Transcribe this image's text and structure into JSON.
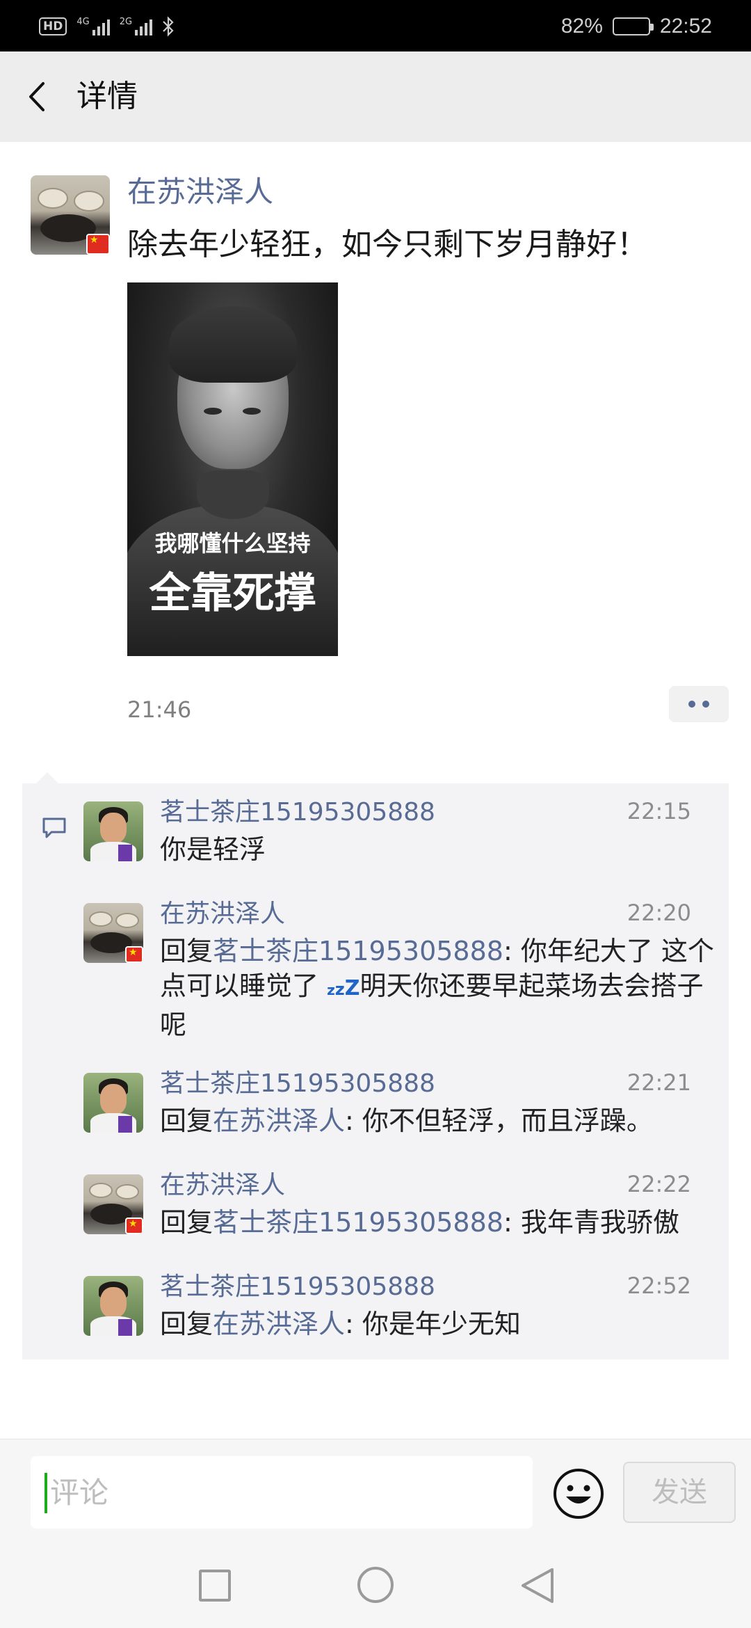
{
  "status_bar": {
    "hd": "HD",
    "net1": "4G",
    "net2": "2G",
    "battery": "82%",
    "battery_level": 0.82,
    "time": "22:52"
  },
  "header": {
    "title": "详情"
  },
  "post": {
    "author": "在苏洪泽人",
    "text": "除去年少轻狂，如今只剩下岁月静好！",
    "image_caption_line1": "我哪懂什么坚持",
    "image_caption_line2": "全靠死撑",
    "time": "21:46"
  },
  "comments": [
    {
      "name": "茗士茶庄15195305888",
      "time": "22:15",
      "text": "你是轻浮",
      "avatar": "man"
    },
    {
      "name": "在苏洪泽人",
      "time": "22:20",
      "reply_prefix": "回复",
      "reply_to": "茗士茶庄15195305888",
      "text_part1": ": 你年纪大了 这个点可以睡觉了 ",
      "text_part2": "明天你还要早起菜场去会搭子呢",
      "avatar": "tea"
    },
    {
      "name": "茗士茶庄15195305888",
      "time": "22:21",
      "reply_prefix": "回复",
      "reply_to": "在苏洪泽人",
      "text": ": 你不但轻浮，而且浮躁。",
      "avatar": "man"
    },
    {
      "name": "在苏洪泽人",
      "time": "22:22",
      "reply_prefix": "回复",
      "reply_to": "茗士茶庄15195305888",
      "text": ": 我年青我骄傲",
      "avatar": "tea"
    },
    {
      "name": "茗士茶庄15195305888",
      "time": "22:52",
      "reply_prefix": "回复",
      "reply_to": "在苏洪泽人",
      "text": ": 你是年少无知",
      "avatar": "man"
    }
  ],
  "input_bar": {
    "placeholder": "评论",
    "send_label": "发送",
    "emoji_icon": "smiley-face-icon"
  },
  "nav_bar": {
    "icons": [
      "recent-apps-icon",
      "home-icon",
      "back-icon"
    ]
  },
  "colors": {
    "link": "#576b95",
    "title_bar_bg": "#ededed",
    "comment_bg": "#f3f3f5",
    "caret": "#1aad19"
  }
}
